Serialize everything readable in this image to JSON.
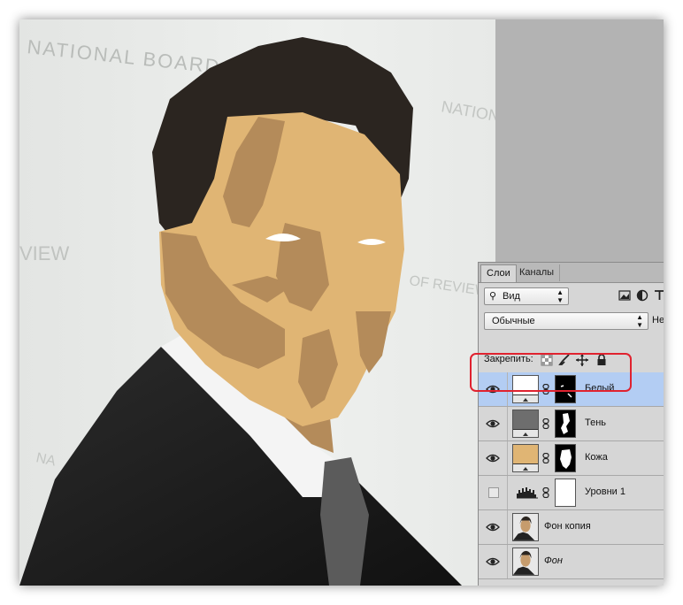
{
  "canvas": {
    "watermark_lines": [
      "NATIONAL BOARD OF",
      "NATIONAL",
      "VIEW",
      "OF REVIEW",
      "NA"
    ]
  },
  "layers_panel": {
    "tabs": [
      {
        "label": "Слои",
        "active": true
      },
      {
        "label": "Каналы",
        "active": false
      }
    ],
    "filter_label": "Вид",
    "blend_mode": "Обычные",
    "opacity_label_cut": "Не",
    "lock_label": "Закрепить:",
    "layers": [
      {
        "name": "Белый",
        "visible": true,
        "selected": true,
        "thumb": "white-fill",
        "mask": true
      },
      {
        "name": "Тень",
        "visible": true,
        "selected": false,
        "thumb": "gray-fill",
        "mask": true
      },
      {
        "name": "Кожа",
        "visible": true,
        "selected": false,
        "thumb": "skin-fill",
        "mask": true
      },
      {
        "name": "Уровни 1",
        "visible": false,
        "selected": false,
        "thumb": "levels-adjustment",
        "mask": true
      },
      {
        "name": "Фон копия",
        "visible": true,
        "selected": false,
        "thumb": "photo",
        "mask": false
      },
      {
        "name": "Фон",
        "visible": true,
        "selected": false,
        "thumb": "photo",
        "mask": false,
        "italic": true
      }
    ],
    "colors": {
      "selected_row": "#b3cdf3",
      "highlight": "#e0222f",
      "skin": "#e0b574",
      "shadow": "#b48b5a",
      "gray_fill": "#6e6e6e"
    }
  }
}
